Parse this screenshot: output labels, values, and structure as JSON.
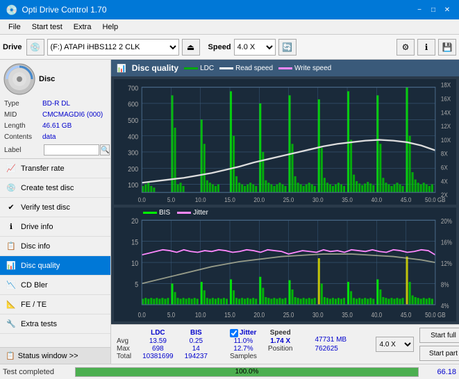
{
  "app": {
    "title": "Opti Drive Control 1.70",
    "title_icon": "💿"
  },
  "titlebar": {
    "title": "Opti Drive Control 1.70",
    "minimize": "−",
    "maximize": "□",
    "close": "✕"
  },
  "menubar": {
    "items": [
      "File",
      "Start test",
      "Extra",
      "Help"
    ]
  },
  "toolbar": {
    "drive_label": "Drive",
    "drive_value": "(F:)  ATAPI iHBS112  2 CLK",
    "speed_label": "Speed",
    "speed_value": "4.0 X"
  },
  "disc_info": {
    "type_label": "Type",
    "type_value": "BD-R DL",
    "mid_label": "MID",
    "mid_value": "CMCMAGDI6 (000)",
    "length_label": "Length",
    "length_value": "46.61 GB",
    "contents_label": "Contents",
    "contents_value": "data",
    "label_label": "Label",
    "label_value": ""
  },
  "nav": {
    "items": [
      {
        "id": "transfer-rate",
        "label": "Transfer rate",
        "icon": "📈"
      },
      {
        "id": "create-test-disc",
        "label": "Create test disc",
        "icon": "💿"
      },
      {
        "id": "verify-test-disc",
        "label": "Verify test disc",
        "icon": "✔"
      },
      {
        "id": "drive-info",
        "label": "Drive info",
        "icon": "ℹ"
      },
      {
        "id": "disc-info",
        "label": "Disc info",
        "icon": "📋"
      },
      {
        "id": "disc-quality",
        "label": "Disc quality",
        "icon": "📊",
        "active": true
      },
      {
        "id": "cd-bler",
        "label": "CD Bler",
        "icon": "📉"
      },
      {
        "id": "fe-te",
        "label": "FE / TE",
        "icon": "📐"
      },
      {
        "id": "extra-tests",
        "label": "Extra tests",
        "icon": "🔧"
      }
    ]
  },
  "status_window": {
    "label": "Status window >>",
    "icon": "📋"
  },
  "disc_quality": {
    "title": "Disc quality",
    "legend": [
      {
        "label": "LDC",
        "color": "#00aa00"
      },
      {
        "label": "Read speed",
        "color": "#ffffff"
      },
      {
        "label": "Write speed",
        "color": "#ff00ff"
      }
    ],
    "chart1": {
      "y_max": 700,
      "y_labels": [
        "700",
        "600",
        "500",
        "400",
        "300",
        "200",
        "100",
        "0"
      ],
      "y2_labels": [
        "18X",
        "16X",
        "14X",
        "12X",
        "10X",
        "8X",
        "6X",
        "4X",
        "2X"
      ],
      "x_max": 50,
      "x_labels": [
        "0.0",
        "5.0",
        "10.0",
        "15.0",
        "20.0",
        "25.0",
        "30.0",
        "35.0",
        "40.0",
        "45.0",
        "50.0 GB"
      ]
    },
    "chart2": {
      "legend": [
        {
          "label": "BIS",
          "color": "#00ff00"
        },
        {
          "label": "Jitter",
          "color": "#ff00ff"
        }
      ],
      "y_max": 20,
      "y_labels": [
        "20",
        "15",
        "10",
        "5"
      ],
      "y2_labels": [
        "20%",
        "16%",
        "12%",
        "8%",
        "4%"
      ],
      "x_max": 50,
      "x_labels": [
        "0.0",
        "5.0",
        "10.0",
        "15.0",
        "20.0",
        "25.0",
        "30.0",
        "35.0",
        "40.0",
        "45.0",
        "50.0 GB"
      ]
    }
  },
  "stats": {
    "headers": [
      "",
      "LDC",
      "BIS",
      "",
      "Jitter",
      "Speed"
    ],
    "avg_label": "Avg",
    "avg_ldc": "13.59",
    "avg_bis": "0.25",
    "avg_jitter": "11.0%",
    "avg_speed": "1.74 X",
    "max_label": "Max",
    "max_ldc": "698",
    "max_bis": "14",
    "max_jitter": "12.7%",
    "max_speed_label": "Position",
    "max_speed_val": "47731 MB",
    "total_label": "Total",
    "total_ldc": "10381699",
    "total_bis": "194237",
    "total_jitter_label": "Samples",
    "total_jitter_val": "762625",
    "speed_select": "4.0 X"
  },
  "buttons": {
    "start_full": "Start full",
    "start_part": "Start part"
  },
  "statusbar": {
    "text": "Test completed",
    "progress": 100,
    "progress_text": "100.0%",
    "speed": "66.18"
  }
}
